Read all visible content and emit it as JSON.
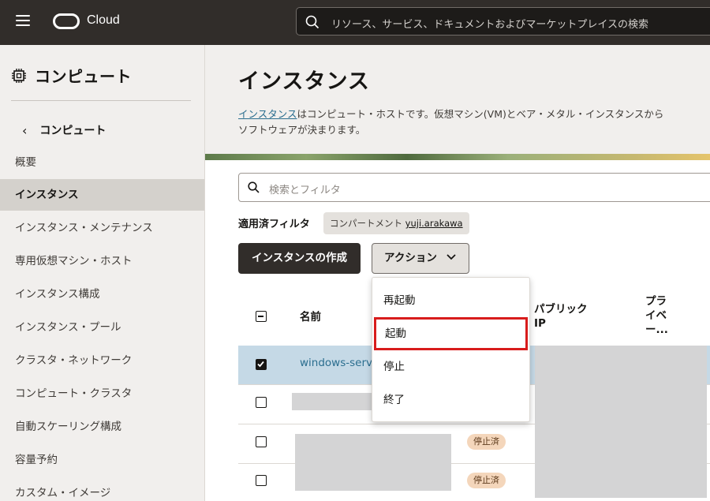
{
  "topbar": {
    "brand": "Cloud",
    "search_placeholder": "リソース、サービス、ドキュメントおよびマーケットプレイスの検索"
  },
  "sidebar": {
    "section_title": "コンピュート",
    "back_label": "コンピュート",
    "items": [
      {
        "label": "概要",
        "active": false
      },
      {
        "label": "インスタンス",
        "active": true
      },
      {
        "label": "インスタンス・メンテナンス",
        "active": false
      },
      {
        "label": "専用仮想マシン・ホスト",
        "active": false
      },
      {
        "label": "インスタンス構成",
        "active": false
      },
      {
        "label": "インスタンス・プール",
        "active": false
      },
      {
        "label": "クラスタ・ネットワーク",
        "active": false
      },
      {
        "label": "コンピュート・クラスタ",
        "active": false
      },
      {
        "label": "自動スケーリング構成",
        "active": false
      },
      {
        "label": "容量予約",
        "active": false
      },
      {
        "label": "カスタム・イメージ",
        "active": false
      }
    ]
  },
  "main": {
    "title": "インスタンス",
    "desc_link": "インスタンス",
    "desc_line1": "はコンピュート・ホストです。仮想マシン(VM)とベア・メタル・インスタンスから",
    "desc_line2": "ソフトウェアが決まります。",
    "filter_placeholder": "検索とフィルタ",
    "applied_filters_label": "適用済フィルタ",
    "chip_prefix": "コンパートメント ",
    "chip_value": "yuji.arakawa",
    "create_button": "インスタンスの作成",
    "actions_button": "アクション"
  },
  "table": {
    "col_name": "名前",
    "col_public_ip_1": "パブリック",
    "col_public_ip_2": "IP",
    "col_private_1": "プラ",
    "col_private_2": "イベ",
    "col_private_3": "ー...",
    "rows": [
      {
        "name": "windows-serv",
        "status": "",
        "selected": true
      },
      {
        "name": "",
        "status": "",
        "selected": false
      },
      {
        "name": "",
        "status": "停止済",
        "selected": false
      },
      {
        "name": "",
        "status": "停止済",
        "selected": false
      }
    ]
  },
  "actions_menu": {
    "items": [
      "再起動",
      "起動",
      "停止",
      "終了"
    ],
    "highlighted": "起動",
    "highlight_color": "#d81c1c"
  }
}
